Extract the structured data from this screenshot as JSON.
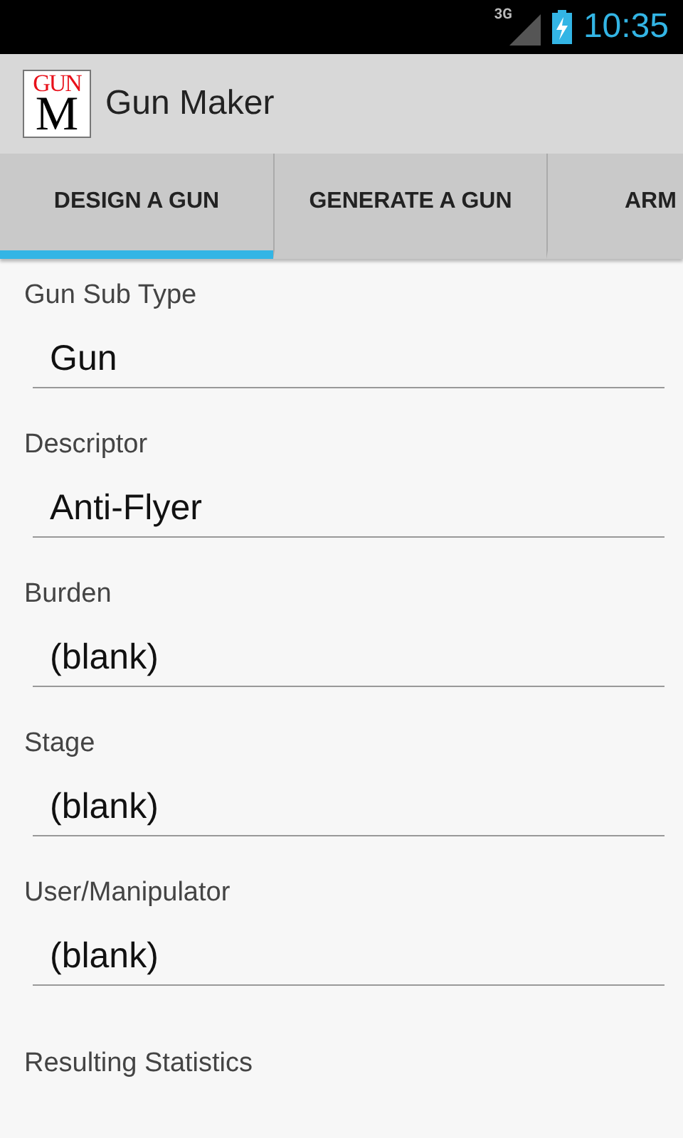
{
  "status_bar": {
    "network": "3G",
    "time": "10:35"
  },
  "action_bar": {
    "logo": {
      "top": "GUN",
      "bottom": "M"
    },
    "title": "Gun Maker"
  },
  "tabs": [
    {
      "label": "DESIGN A GUN",
      "selected": true
    },
    {
      "label": "GENERATE A GUN",
      "selected": false
    },
    {
      "label": "ARM",
      "selected": false
    }
  ],
  "fields": [
    {
      "label": "Gun Sub Type",
      "value": "Gun"
    },
    {
      "label": "Descriptor",
      "value": "Anti-Flyer"
    },
    {
      "label": "Burden",
      "value": "(blank)"
    },
    {
      "label": "Stage",
      "value": "(blank)"
    },
    {
      "label": "User/Manipulator",
      "value": "(blank)"
    }
  ],
  "section_heading": "Resulting Statistics"
}
